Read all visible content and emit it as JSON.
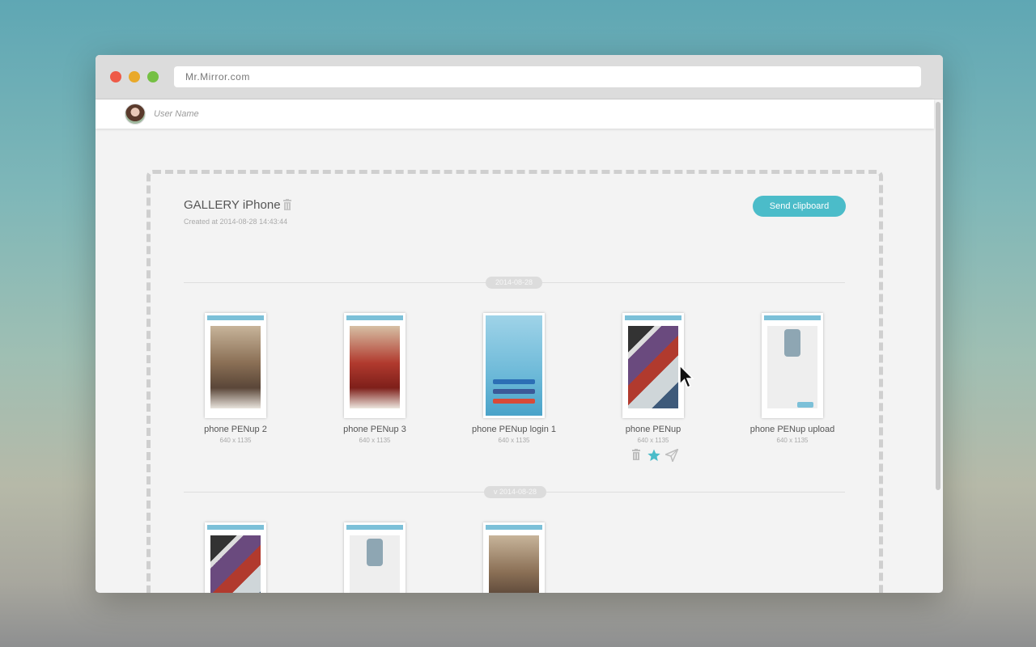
{
  "browser": {
    "url": "Mr.Mirror.com"
  },
  "header": {
    "user_name": "User Name"
  },
  "gallery": {
    "title": "GALLERY iPhone",
    "created": "Created at 2014-08-28 14:43:44",
    "send_label": "Send clipboard"
  },
  "sections": [
    {
      "date": "2014-08-28",
      "items": [
        {
          "name": "phone PENup 2",
          "size": "640 x 1135"
        },
        {
          "name": "phone PENup 3",
          "size": "640 x 1135"
        },
        {
          "name": "phone PENup login 1",
          "size": "640 x 1135"
        },
        {
          "name": "phone PENup",
          "size": "640 x 1135"
        },
        {
          "name": "phone PENup upload",
          "size": "640 x 1135"
        }
      ]
    },
    {
      "date": "v 2014-08-28",
      "items": [
        {
          "name": "",
          "size": ""
        },
        {
          "name": "",
          "size": ""
        },
        {
          "name": "",
          "size": ""
        }
      ]
    }
  ],
  "item_actions": [
    "trash-icon",
    "star-icon",
    "send-icon"
  ],
  "colors": {
    "accent": "#4bbcc9",
    "traffic_red": "#ee5a48",
    "traffic_yellow": "#e9a92a",
    "traffic_green": "#75c044"
  }
}
